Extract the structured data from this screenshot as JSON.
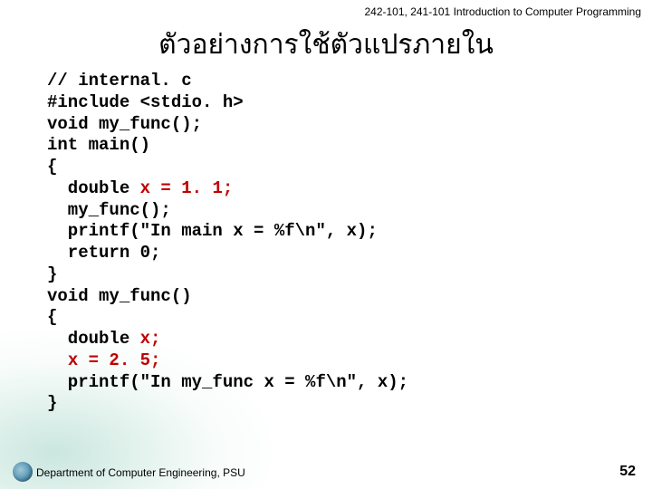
{
  "header": {
    "course": "242-101, 241-101 Introduction to Computer Programming"
  },
  "title": "ตัวอย่างการใช้ตัวแปรภายใน",
  "code": {
    "l01": "// internal. c",
    "l02": "#include <stdio. h>",
    "l03": "void my_func();",
    "l04": "int main()",
    "l05": "{",
    "l06": "  double ",
    "l06r": "x = 1. 1;",
    "l07": "  my_func();",
    "l08": "  printf(\"In main x = %f\\n\", x);",
    "l09": "  return 0;",
    "l10": "}",
    "l11": "void my_func()",
    "l12": "{",
    "l13": "  double ",
    "l13r": "x;",
    "l14": "  ",
    "l14r": "x = 2. 5;",
    "l15": "  printf(\"In my_func x = %f\\n\", x);",
    "l16": "}"
  },
  "footer": {
    "dept": "Department of Computer Engineering, PSU",
    "page": "52"
  }
}
